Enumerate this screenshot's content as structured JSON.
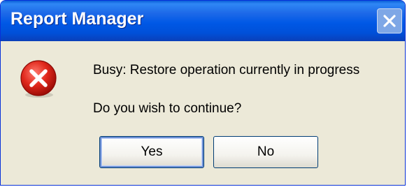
{
  "window": {
    "title": "Report Manager"
  },
  "title_bar": {
    "close_icon": "close-x-icon"
  },
  "message": {
    "icon": "error-icon",
    "line1": "Busy: Restore operation currently in progress",
    "line2": "Do you wish to continue?"
  },
  "buttons": {
    "yes_label": "Yes",
    "no_label": "No"
  },
  "colors": {
    "titlebar": "#0058e6",
    "dialog_bg": "#ece9d8",
    "error_red": "#d8261b"
  }
}
